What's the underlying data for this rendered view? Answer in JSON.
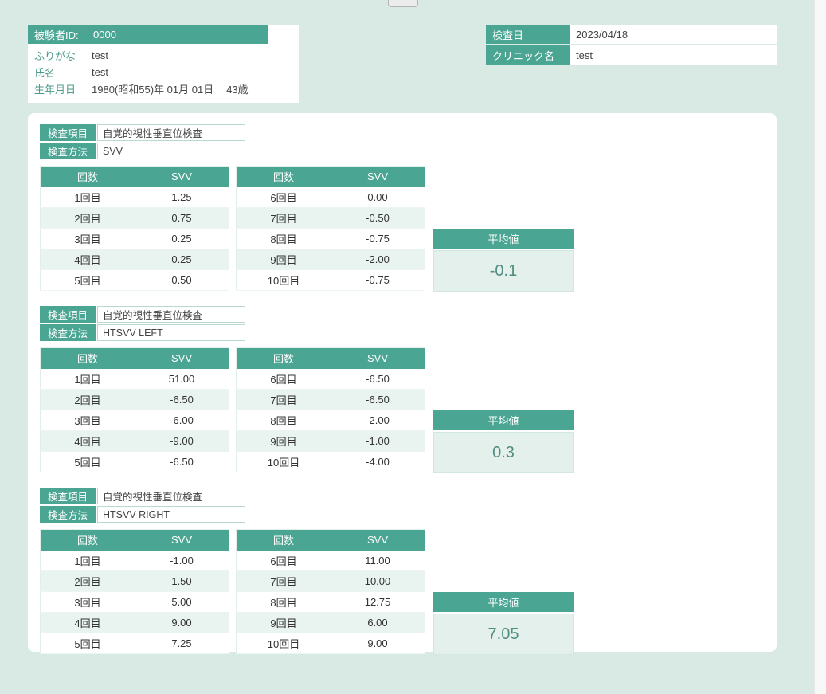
{
  "ui": {
    "accent": "#4ba593",
    "page_bg": "#d9eae4",
    "stripe": "#e9f4f0"
  },
  "patient": {
    "id_label": "被験者ID:",
    "id_value": "0000",
    "fields": [
      {
        "label": "ふりがな",
        "value": "test"
      },
      {
        "label": "氏名",
        "value": "test"
      },
      {
        "label": "生年月日",
        "value": "1980(昭和55)年 01月 01日",
        "extra": "43歳"
      }
    ]
  },
  "exam_info": {
    "rows": [
      {
        "label": "検査日",
        "value": "2023/04/18"
      },
      {
        "label": "クリニック名",
        "value": "test"
      }
    ]
  },
  "sections": [
    {
      "item_label": "検査項目",
      "item_value": "自覚的視性垂直位検査",
      "method_label": "検査方法",
      "method_value": "SVV",
      "headers": [
        "回数",
        "SVV"
      ],
      "left_rows": [
        [
          "1回目",
          "1.25"
        ],
        [
          "2回目",
          "0.75"
        ],
        [
          "3回目",
          "0.25"
        ],
        [
          "4回目",
          "0.25"
        ],
        [
          "5回目",
          "0.50"
        ]
      ],
      "right_rows": [
        [
          "6回目",
          "0.00"
        ],
        [
          "7回目",
          "-0.50"
        ],
        [
          "8回目",
          "-0.75"
        ],
        [
          "9回目",
          "-2.00"
        ],
        [
          "10回目",
          "-0.75"
        ]
      ],
      "average_label": "平均値",
      "average_value": "-0.1"
    },
    {
      "item_label": "検査項目",
      "item_value": "自覚的視性垂直位検査",
      "method_label": "検査方法",
      "method_value": "HTSVV LEFT",
      "headers": [
        "回数",
        "SVV"
      ],
      "left_rows": [
        [
          "1回目",
          "51.00"
        ],
        [
          "2回目",
          "-6.50"
        ],
        [
          "3回目",
          "-6.00"
        ],
        [
          "4回目",
          "-9.00"
        ],
        [
          "5回目",
          "-6.50"
        ]
      ],
      "right_rows": [
        [
          "6回目",
          "-6.50"
        ],
        [
          "7回目",
          "-6.50"
        ],
        [
          "8回目",
          "-2.00"
        ],
        [
          "9回目",
          "-1.00"
        ],
        [
          "10回目",
          "-4.00"
        ]
      ],
      "average_label": "平均値",
      "average_value": "0.3"
    },
    {
      "item_label": "検査項目",
      "item_value": "自覚的視性垂直位検査",
      "method_label": "検査方法",
      "method_value": "HTSVV RIGHT",
      "headers": [
        "回数",
        "SVV"
      ],
      "left_rows": [
        [
          "1回目",
          "-1.00"
        ],
        [
          "2回目",
          "1.50"
        ],
        [
          "3回目",
          "5.00"
        ],
        [
          "4回目",
          "9.00"
        ],
        [
          "5回目",
          "7.25"
        ]
      ],
      "right_rows": [
        [
          "6回目",
          "11.00"
        ],
        [
          "7回目",
          "10.00"
        ],
        [
          "8回目",
          "12.75"
        ],
        [
          "9回目",
          "6.00"
        ],
        [
          "10回目",
          "9.00"
        ]
      ],
      "average_label": "平均値",
      "average_value": "7.05"
    }
  ]
}
